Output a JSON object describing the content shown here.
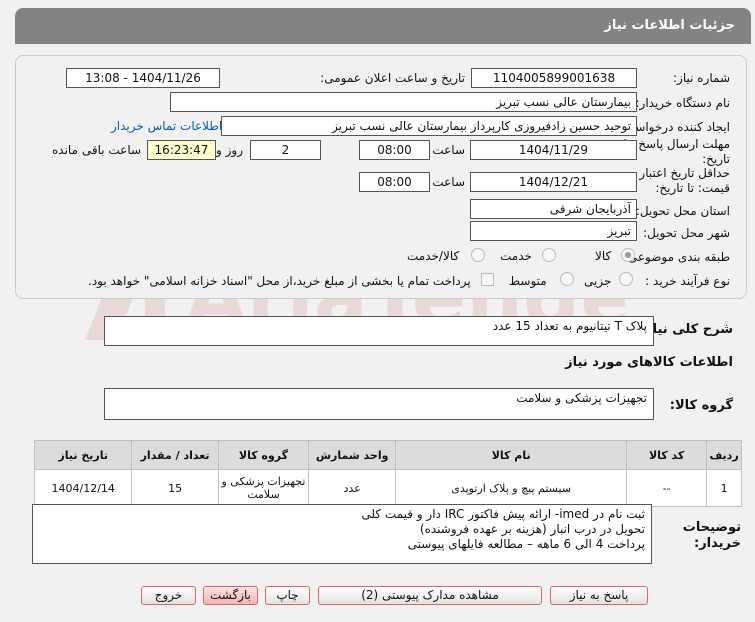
{
  "header": {
    "title": "جزئیات اطلاعات نیاز"
  },
  "form": {
    "need_number_label": "شماره نیاز:",
    "need_number": "1104005899001638",
    "announce_label": "تاریخ و ساعت اعلان عمومی:",
    "announce_value": "1404/11/26 - 13:08",
    "buyer_org_label": "نام دستگاه خریدار:",
    "buyer_org": "بیمارستان عالی نسب تبریز",
    "creator_label": "ایجاد کننده درخواست:",
    "creator": "توحید حسین زادفیروزی کارپرداز بیمارستان عالی نسب تبریز",
    "contact_link": "اطلاعات تماس خریدار",
    "deadline_label_1": "مهلت ارسال پاسخ: تا",
    "deadline_label_2": "تاریخ:",
    "deadline_date": "1404/11/29",
    "time_label": "ساعت",
    "deadline_time": "08:00",
    "days_value": "2",
    "days_label": "روز و",
    "remaining_time": "16:23:47",
    "remaining_label": "ساعت باقی مانده",
    "validity_label_1": "حداقل تاریخ اعتبار",
    "validity_label_2": "قیمت: تا تاریخ:",
    "validity_date": "1404/12/21",
    "validity_time": "08:00",
    "province_label": "استان محل تحویل:",
    "province": "آذربایجان شرقی",
    "city_label": "شهر محل تحویل:",
    "city": "تبریز",
    "category_label": "طبقه بندی موضوعی:",
    "category_options": [
      "کالا",
      "خدمت",
      "کالا/خدمت"
    ],
    "process_label": "نوع فرآیند خرید :",
    "process_options": [
      "جزیی",
      "متوسط"
    ],
    "payment_note": "پرداخت تمام یا بخشی از مبلغ خرید،از محل \"اسناد خزانه اسلامی\" خواهد بود."
  },
  "summary": {
    "label": "شرح کلی نیاز:",
    "value": "پلاک T تیتانیوم به تعداد 15 عدد"
  },
  "goods": {
    "section_title": "اطلاعات کالاهای مورد نیاز",
    "group_label": "گروه کالا:",
    "group_value": "تجهیزات پزشکی و سلامت"
  },
  "table": {
    "headers": [
      "ردیف",
      "کد کالا",
      "نام کالا",
      "واحد شمارش",
      "گروه کالا",
      "تعداد / مقدار",
      "تاریخ نیاز"
    ],
    "rows": [
      [
        "1",
        "--",
        "سیستم پیچ و پلاک ارتوپدی",
        "عدد",
        "تجهیزات پزشکی و سلامت",
        "15",
        "1404/12/14"
      ]
    ]
  },
  "notes": {
    "label_1": "توضیحات",
    "label_2": "خریدار:",
    "line_1": "ثبت نام در imed- ارائه پیش فاکتور IRC دار و قیمت کلی",
    "line_2": "تحویل در درب انبار (هزینه بر عهده فروشنده)",
    "line_3": "پرداخت  4 الی 6 ماهه – مطالعه فایلهای پیوستی"
  },
  "buttons": {
    "reply": "پاسخ به نیاز",
    "docs": "مشاهده مدارک پیوستی (2)",
    "print": "چاپ",
    "back": "بازگشت",
    "exit": "خروج"
  },
  "watermark": {
    "text": "AriaTender.neT"
  }
}
